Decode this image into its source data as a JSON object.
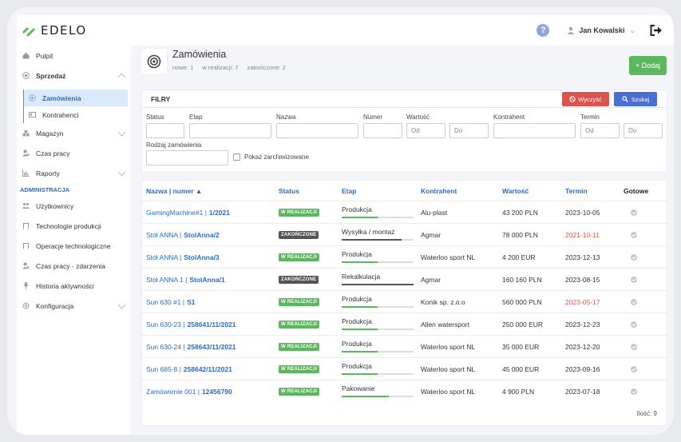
{
  "app": {
    "logo_text": "EDELO"
  },
  "topbar": {
    "user_name": "Jan Kowalski",
    "help_label": "?"
  },
  "sidebar": {
    "items": [
      {
        "label": "Pulpit"
      },
      {
        "label": "Sprzedaż"
      },
      {
        "label": "Zamówienia"
      },
      {
        "label": "Kontrahenci"
      },
      {
        "label": "Magazyn"
      },
      {
        "label": "Czas pracy"
      },
      {
        "label": "Raporty"
      }
    ],
    "section_admin": "ADMINISTRACJA",
    "admin_items": [
      {
        "label": "Użytkownicy"
      },
      {
        "label": "Technologie produkcji"
      },
      {
        "label": "Operacje technologiczne"
      },
      {
        "label": "Czas pracy - zdarzenia"
      },
      {
        "label": "Historia aktywności"
      },
      {
        "label": "Konfiguracja"
      }
    ]
  },
  "header": {
    "title": "Zamówienia",
    "stat_new": "nowe: 1",
    "stat_inprogress": "w realizacji: 7",
    "stat_done": "zakończone: 2",
    "add_label": "+ Dodaj"
  },
  "filters": {
    "title": "FILRY",
    "clear_label": "Wyczyść",
    "search_label": "Szukaj",
    "status_label": "Status",
    "etap_label": "Etap",
    "nazwa_label": "Nazwa",
    "numer_label": "Numer",
    "wartosc_label": "Wartość",
    "wartosc_from_placeholder": "Od",
    "wartosc_to_placeholder": "Do",
    "kontrahent_label": "Kontrahent",
    "termin_label": "Termin",
    "termin_from_placeholder": "Od",
    "termin_to_placeholder": "Do",
    "rodzaj_label": "Rodzaj zamówienia",
    "archived_label": "Pokaż zarchiwizowane"
  },
  "table": {
    "headers": {
      "name": "Nazwa | numer ▲",
      "status": "Status",
      "etap": "Etap",
      "kontrahent": "Kontrahent",
      "wartosc": "Wartość",
      "termin": "Termin",
      "gotowe": "Gotowe"
    },
    "rows": [
      {
        "name": "GamingMachine#1 |",
        "number": "1/2021",
        "status": "W REALIZACJI",
        "etap": "Produkcja",
        "progress": 0.5,
        "kontrahent": "Alu-plast",
        "wartosc": "43 200 PLN",
        "termin": "2023-10-05",
        "overdue": false
      },
      {
        "name": "Stół ANNA |",
        "number": "StolAnna/2",
        "status": "ZAKOŃCZONE",
        "etap": "Wysyłka / montaż",
        "progress": 0.83,
        "kontrahent": "Agmar",
        "wartosc": "78 000 PLN",
        "termin": "2021-10-11",
        "overdue": true
      },
      {
        "name": "Stół ANNA |",
        "number": "StolAnna/3",
        "status": "W REALIZACJI",
        "etap": "Produkcja",
        "progress": 0.5,
        "kontrahent": "Waterloo sport NL",
        "wartosc": "4 200 EUR",
        "termin": "2023-12-13",
        "overdue": false
      },
      {
        "name": "Stół ANNA 1 |",
        "number": "StolAnna/1",
        "status": "ZAKOŃCZONE",
        "etap": "Rekalkulacja",
        "progress": 1.0,
        "kontrahent": "Agmar",
        "wartosc": "160 160 PLN",
        "termin": "2023-08-15",
        "overdue": false
      },
      {
        "name": "Sun 630 #1 |",
        "number": "S1",
        "status": "W REALIZACJI",
        "etap": "Produkcja",
        "progress": 0.5,
        "kontrahent": "Konik sp. z.o.o",
        "wartosc": "560 000 PLN",
        "termin": "2023-05-17",
        "overdue": true
      },
      {
        "name": "Sun 630-23 |",
        "number": "258641/11/2021",
        "status": "W REALIZACJI",
        "etap": "Produkcja",
        "progress": 0.5,
        "kontrahent": "Allen watersport",
        "wartosc": "250 000 EUR",
        "termin": "2023-12-23",
        "overdue": false
      },
      {
        "name": "Sun 630-24 |",
        "number": "258643/11/2021",
        "status": "W REALIZACJI",
        "etap": "Produkcja",
        "progress": 0.5,
        "kontrahent": "Waterloo sport NL",
        "wartosc": "35 000 EUR",
        "termin": "2023-12-20",
        "overdue": false
      },
      {
        "name": "Sun 685-8 |",
        "number": "258642/11/2021",
        "status": "W REALIZACJI",
        "etap": "Produkcja",
        "progress": 0.5,
        "kontrahent": "Waterloo sport NL",
        "wartosc": "45 000 EUR",
        "termin": "2023-09-16",
        "overdue": false
      },
      {
        "name": "Zamówienie 001 |",
        "number": "12456790",
        "status": "W REALIZACJI",
        "etap": "Pakowanie",
        "progress": 0.66,
        "kontrahent": "Waterloo sport NL",
        "wartosc": "4 900 PLN",
        "termin": "2023-07-18",
        "overdue": false
      }
    ],
    "count_label": "Ilość: 9"
  },
  "colors": {
    "accent": "#2b6bc4",
    "success": "#5cb85c",
    "danger": "#d9534f",
    "done": "#555555"
  }
}
